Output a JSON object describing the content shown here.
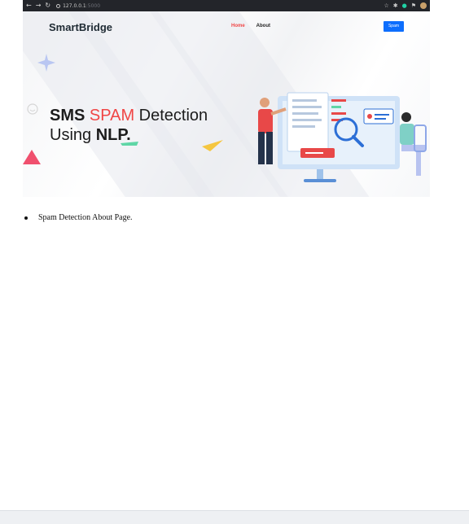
{
  "browser": {
    "url_host": "127.0.0.1",
    "url_port": ":5000"
  },
  "header": {
    "brand": "SmartBridge",
    "nav": [
      {
        "label": "Home"
      },
      {
        "label": "About"
      }
    ],
    "button_label": "Spam"
  },
  "hero": {
    "word_sms": "SMS",
    "word_spam": "SPAM",
    "word_detection": "Detection",
    "word_using": "Using",
    "word_nlp": "NLP."
  },
  "content": {
    "items": [
      {
        "text": "Spam Detection About Page."
      }
    ]
  },
  "colors": {
    "accent_red": "#f04545",
    "button_blue": "#0d6efd",
    "browser_dark": "#23252a"
  }
}
